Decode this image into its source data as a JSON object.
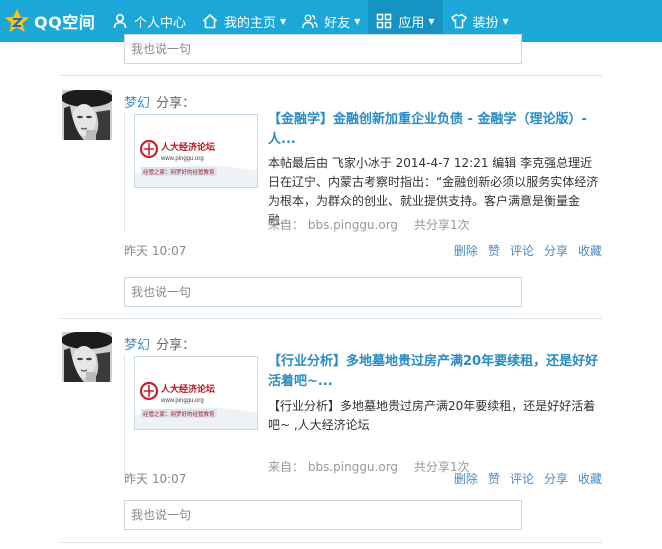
{
  "nav": {
    "logo_text": "QQ空间",
    "items": [
      {
        "label": "个人中心",
        "icon": "person-icon"
      },
      {
        "label": "我的主页",
        "icon": "home-icon",
        "caret": true
      },
      {
        "label": "好友",
        "icon": "friends-icon",
        "caret": true
      },
      {
        "label": "应用",
        "icon": "apps-icon",
        "caret": true,
        "active": true
      },
      {
        "label": "装扮",
        "icon": "shirt-icon",
        "caret": true
      }
    ]
  },
  "comment_placeholder": "我也说一句",
  "posts": [
    {
      "author": "梦幻",
      "verb": "分享：",
      "thumb_site": "人大经济论坛",
      "thumb_url": "www.pinggu.org",
      "thumb_slogan": "经管之家：网罗好的经管教育",
      "title": "【金融学】金融创新加重企业负债 - 金融学（理论版）- 人...",
      "body": "本帖最后由 飞家小冰于 2014-4-7 12:21 编辑 李克强总理近日在辽宁、内蒙古考察时指出：“金融创新必须以服务实体经济为根本，为群众的创业、就业提供支持。客户满意是衡量金融...",
      "source_label": "来自：",
      "source": "bbs.pinggu.org",
      "share_count": "共分享1次",
      "time": "昨天 10:07",
      "actions": [
        "删除",
        "赞",
        "评论",
        "分享",
        "收藏"
      ]
    },
    {
      "author": "梦幻",
      "verb": "分享：",
      "thumb_site": "人大经济论坛",
      "thumb_url": "www.pinggu.org",
      "thumb_slogan": "经管之家：网罗好的经管教育",
      "title": "【行业分析】多地墓地贵过房产满20年要续租，还是好好活着吧~...",
      "body": "【行业分析】多地墓地贵过房产满20年要续租，还是好好活着吧~ ,人大经济论坛",
      "source_label": "来自：",
      "source": "bbs.pinggu.org",
      "share_count": "共分享1次",
      "time": "昨天 10:07",
      "actions": [
        "删除",
        "赞",
        "评论",
        "分享",
        "收藏"
      ]
    }
  ],
  "colors": {
    "nav_bg": "#1ba7d8",
    "link": "#4a8bc2",
    "title": "#2b8bc3"
  }
}
